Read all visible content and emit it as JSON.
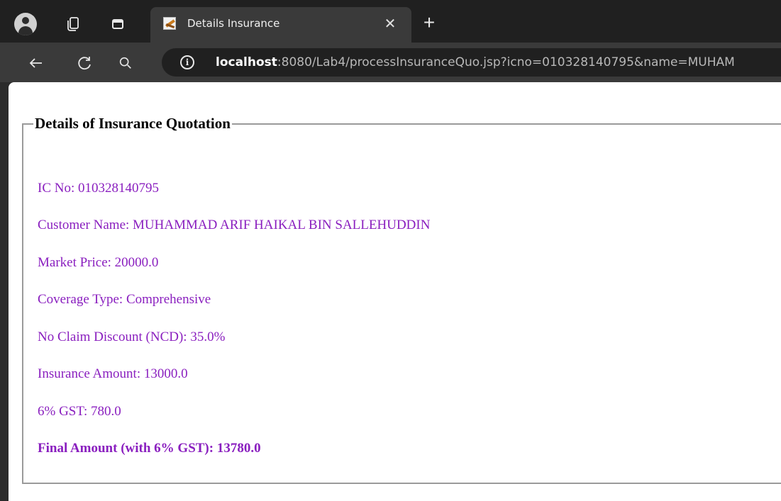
{
  "tab": {
    "title": "Details Insurance"
  },
  "address_bar": {
    "host": "localhost",
    "rest": ":8080/Lab4/processInsuranceQuo.jsp?icno=010328140795&name=MUHAM"
  },
  "page": {
    "legend": "Details of Insurance Quotation",
    "lines": {
      "ic_no": "IC No: 010328140795",
      "customer_name": "Customer Name: MUHAMMAD ARIF HAIKAL BIN SALLEHUDDIN",
      "market_price": "Market Price: 20000.0",
      "coverage_type": "Coverage Type: Comprehensive",
      "ncd": "No Claim Discount (NCD): 35.0%",
      "insurance_amount": "Insurance Amount: 13000.0",
      "gst": "6% GST: 780.0",
      "final_amount": "Final Amount (with 6% GST): 13780.0"
    }
  },
  "colors": {
    "text": "#8a1fbf"
  }
}
